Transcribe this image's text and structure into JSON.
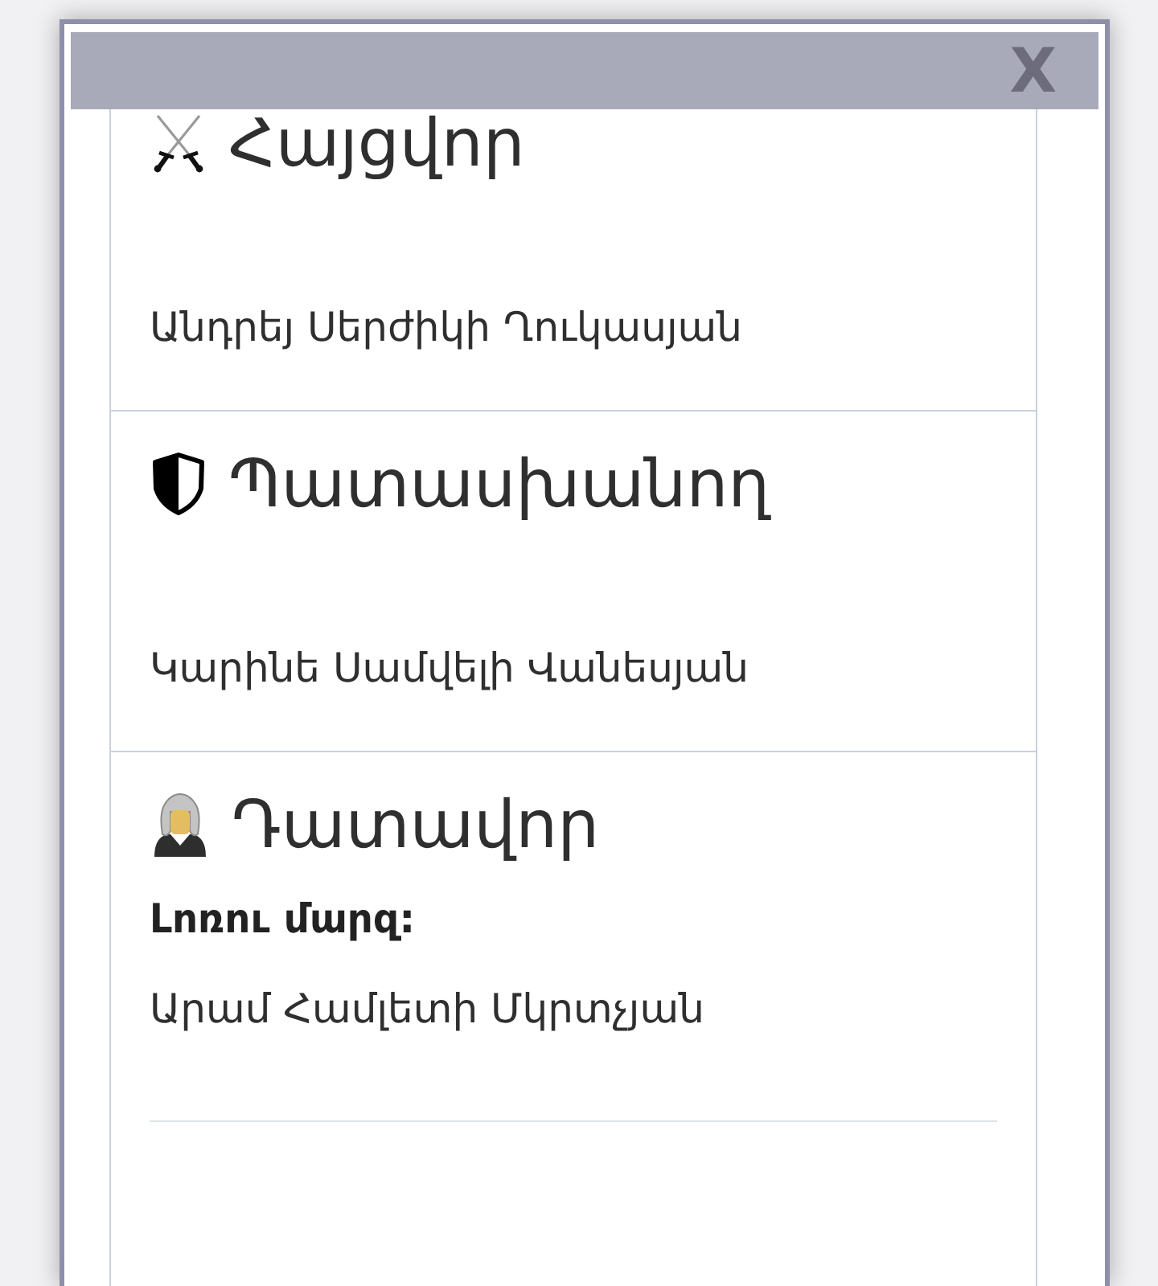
{
  "dialog": {
    "close_label": "X"
  },
  "parties": [
    {
      "kind": "plaintiff",
      "role": "Հայցվոր",
      "name": "Անդրեյ Սերժիկի Ղուկասյան"
    },
    {
      "kind": "defendant",
      "role": "Պատասխանող",
      "name": "Կարինե Սամվելի Վանեսյան"
    },
    {
      "kind": "judge",
      "role": "Դատավոր",
      "region": "Լոռու մարզ:",
      "name": "Արամ Համլետի Մկրտչյան"
    }
  ]
}
